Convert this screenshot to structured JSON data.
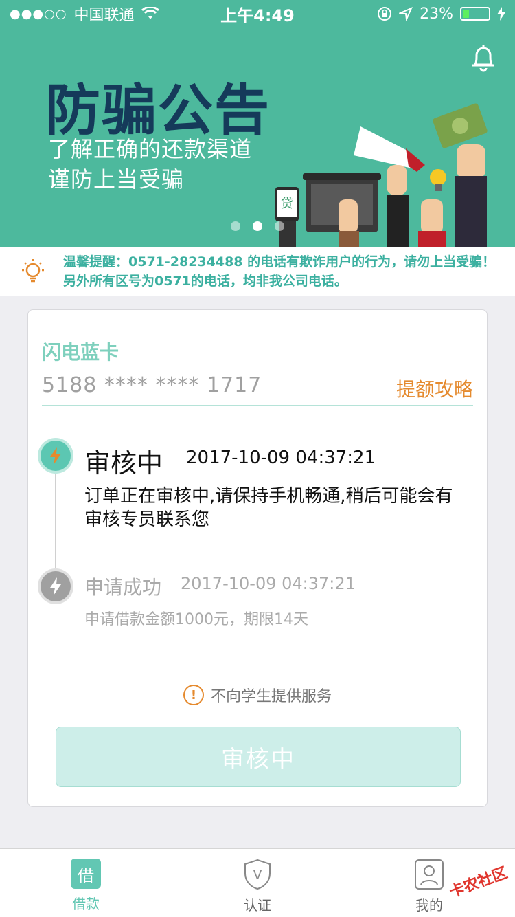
{
  "status_bar": {
    "signal": "●●●○○",
    "carrier": "中国联通",
    "time": "上午4:49",
    "battery_percent": "23%",
    "battery_level": 0.23
  },
  "banner": {
    "title": "防骗公告",
    "subtitle_line1": "了解正确的还款渠道",
    "subtitle_line2": "谨防上当受骗",
    "phone_logo_text": "贷",
    "slides_count": 3,
    "active_slide": 1
  },
  "notice": {
    "text": "温馨提醒：0571-28234488 的电话有欺诈用户的行为，请勿上当受骗！另外所有区号为0571的电话，均非我公司电话。"
  },
  "card": {
    "name": "闪电蓝卡",
    "number": "5188 **** **** 1717",
    "limit_link": "提额攻略"
  },
  "timeline": [
    {
      "title": "审核中",
      "time": "2017-10-09 04:37:21",
      "desc": "订单正在审核中,请保持手机畅通,稍后可能会有审核专员联系您",
      "state": "active"
    },
    {
      "title": "申请成功",
      "time": "2017-10-09 04:37:21",
      "desc": "申请借款金额1000元，期限14天",
      "state": "done"
    }
  ],
  "student_notice": "不向学生提供服务",
  "main_button": "审核中",
  "tabs": [
    {
      "label": "借款",
      "icon": "借",
      "active": true
    },
    {
      "label": "认证",
      "icon": "V",
      "active": false
    },
    {
      "label": "我的",
      "icon": "user",
      "active": false
    }
  ],
  "watermark": "卡农社区",
  "colors": {
    "banner": "#4db99d",
    "accent": "#62c7b3",
    "orange": "#e58a2e",
    "notice_text": "#3cb0a0"
  }
}
